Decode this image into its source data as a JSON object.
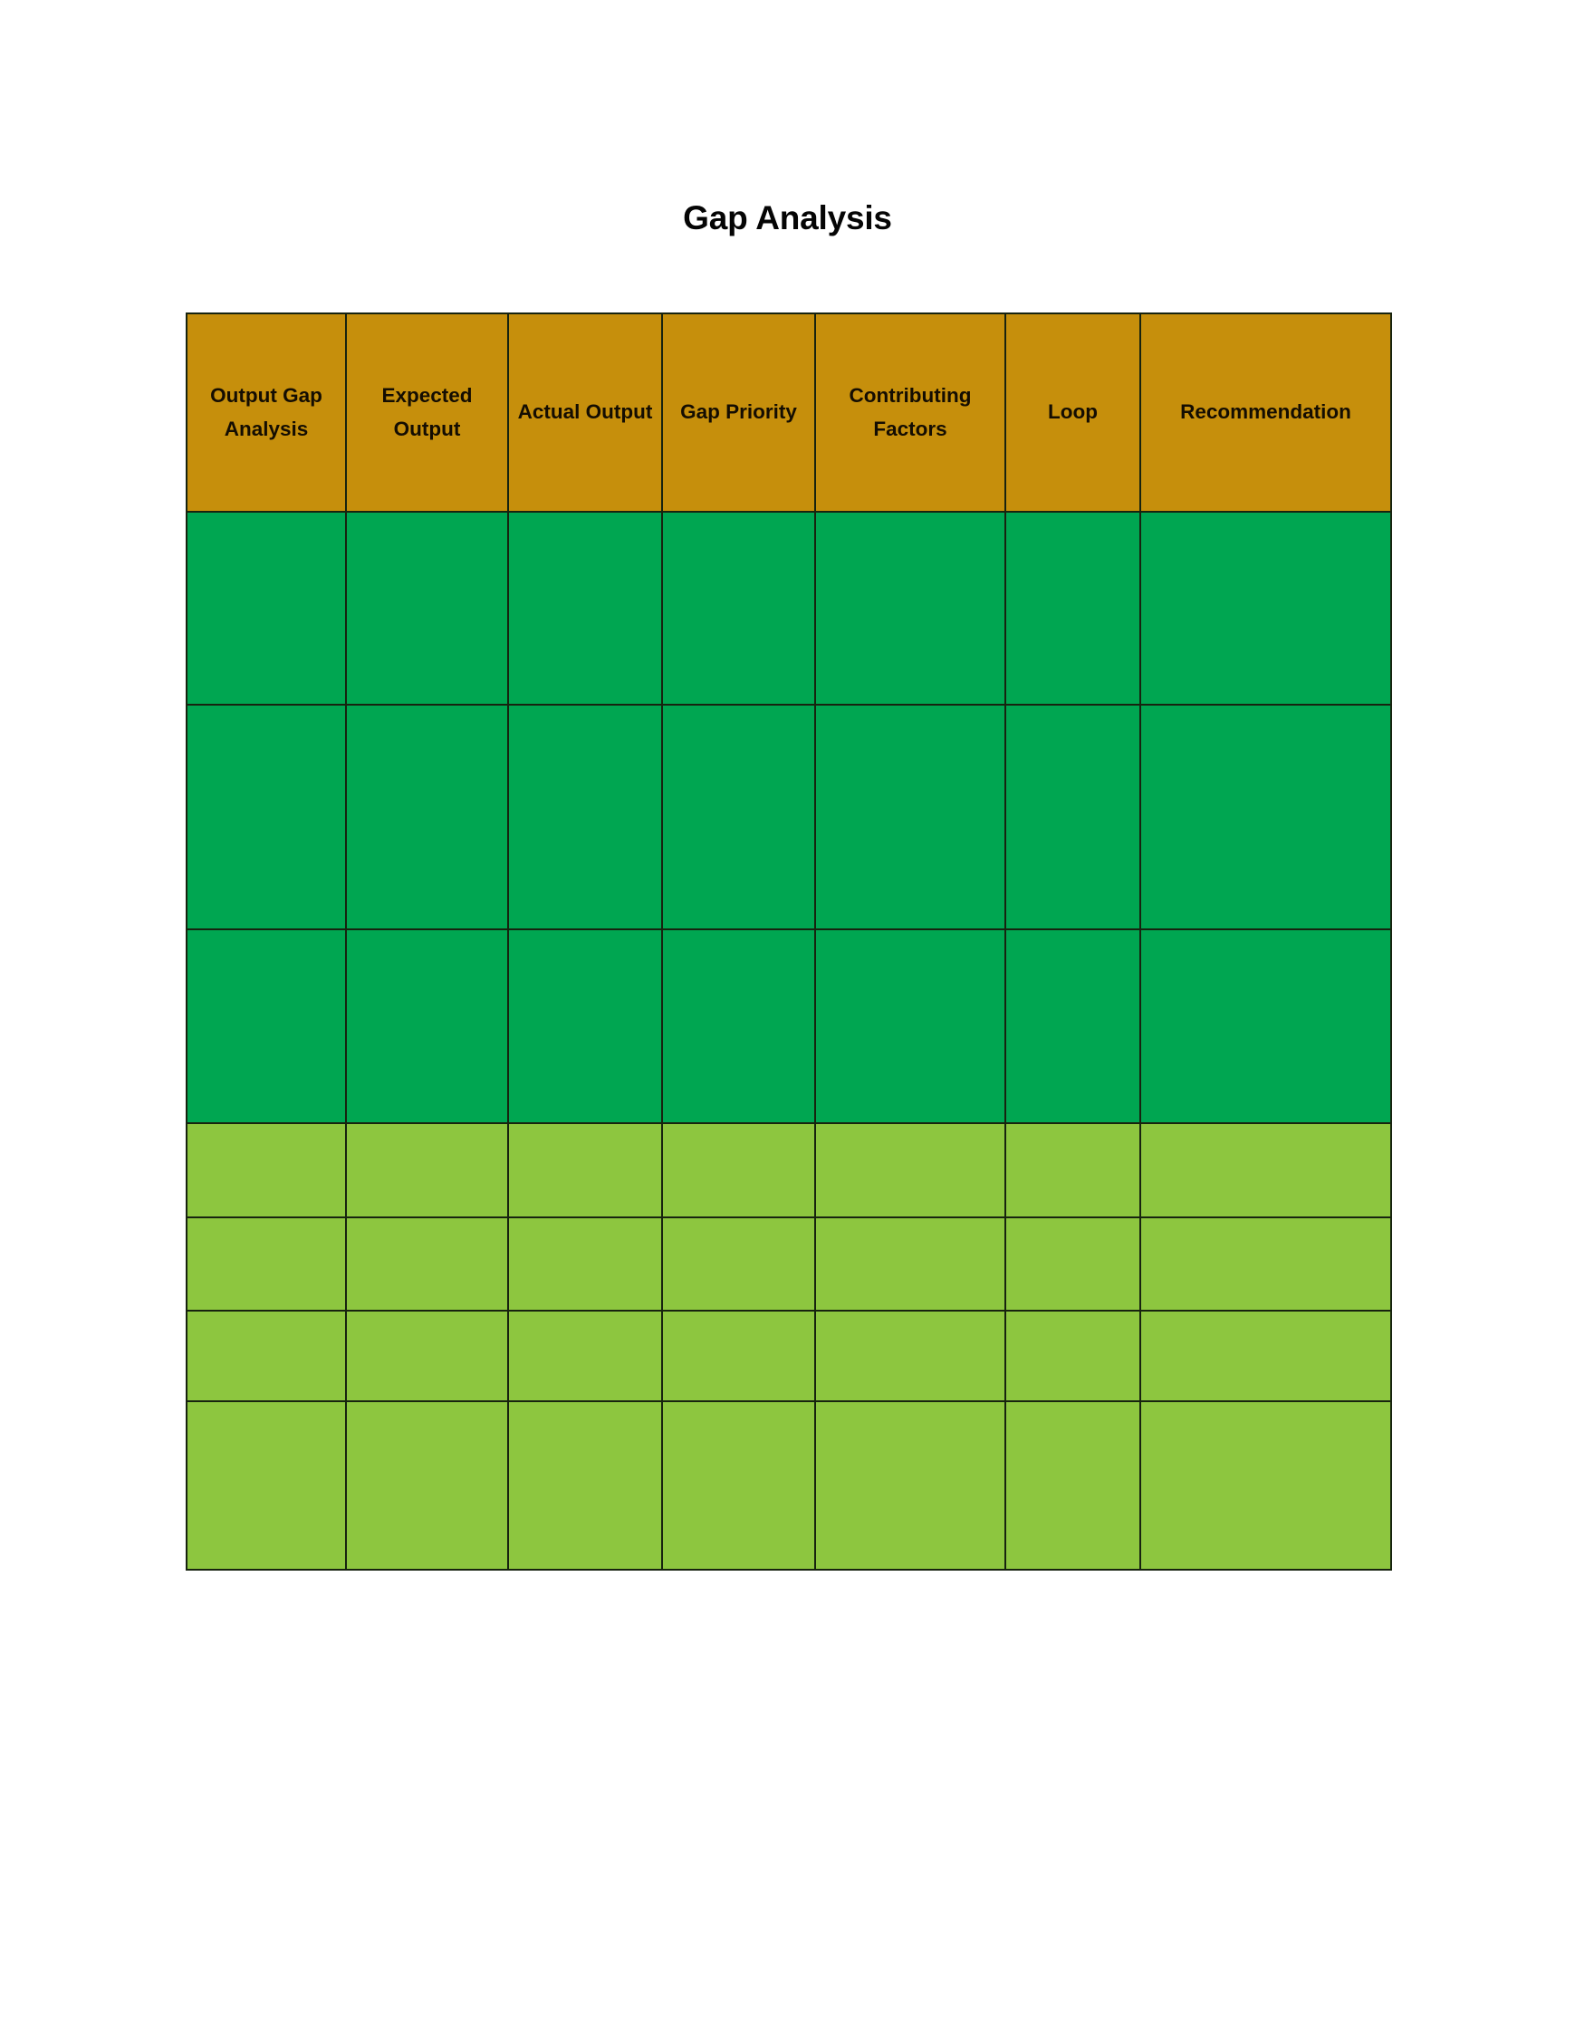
{
  "document": {
    "title": "Gap Analysis",
    "background_color": "#ffffff"
  },
  "colors": {
    "header_background": "#c68f0c",
    "header_text": "#140d02",
    "row_dark_green": "#00a651",
    "row_light_green": "#8dc63f",
    "border": "#17230f",
    "title_text": "#050505"
  },
  "table": {
    "columns": [
      {
        "key": "output_gap_analysis",
        "label": "Output Gap Analysis"
      },
      {
        "key": "expected_output",
        "label": "Expected Output"
      },
      {
        "key": "actual_output",
        "label": "Actual Output"
      },
      {
        "key": "gap_priority",
        "label": "Gap Priority"
      },
      {
        "key": "contributing_factors",
        "label": "Contributing Factors"
      },
      {
        "key": "loop",
        "label": "Loop"
      },
      {
        "key": "recommendation",
        "label": "Recommendation"
      }
    ],
    "rows": [
      {
        "id": "row-1",
        "fill": "dark",
        "cells": [
          "",
          "",
          "",
          "",
          "",
          "",
          ""
        ]
      },
      {
        "id": "row-2",
        "fill": "dark",
        "cells": [
          "",
          "",
          "",
          "",
          "",
          "",
          ""
        ]
      },
      {
        "id": "row-3",
        "fill": "dark",
        "cells": [
          "",
          "",
          "",
          "",
          "",
          "",
          ""
        ]
      },
      {
        "id": "row-4",
        "fill": "light",
        "cells": [
          "",
          "",
          "",
          "",
          "",
          "",
          ""
        ]
      },
      {
        "id": "row-5",
        "fill": "light",
        "cells": [
          "",
          "",
          "",
          "",
          "",
          "",
          ""
        ]
      },
      {
        "id": "row-6",
        "fill": "light",
        "cells": [
          "",
          "",
          "",
          "",
          "",
          "",
          ""
        ]
      },
      {
        "id": "row-7",
        "fill": "light",
        "cells": [
          "",
          "",
          "",
          "",
          "",
          "",
          ""
        ]
      }
    ]
  }
}
